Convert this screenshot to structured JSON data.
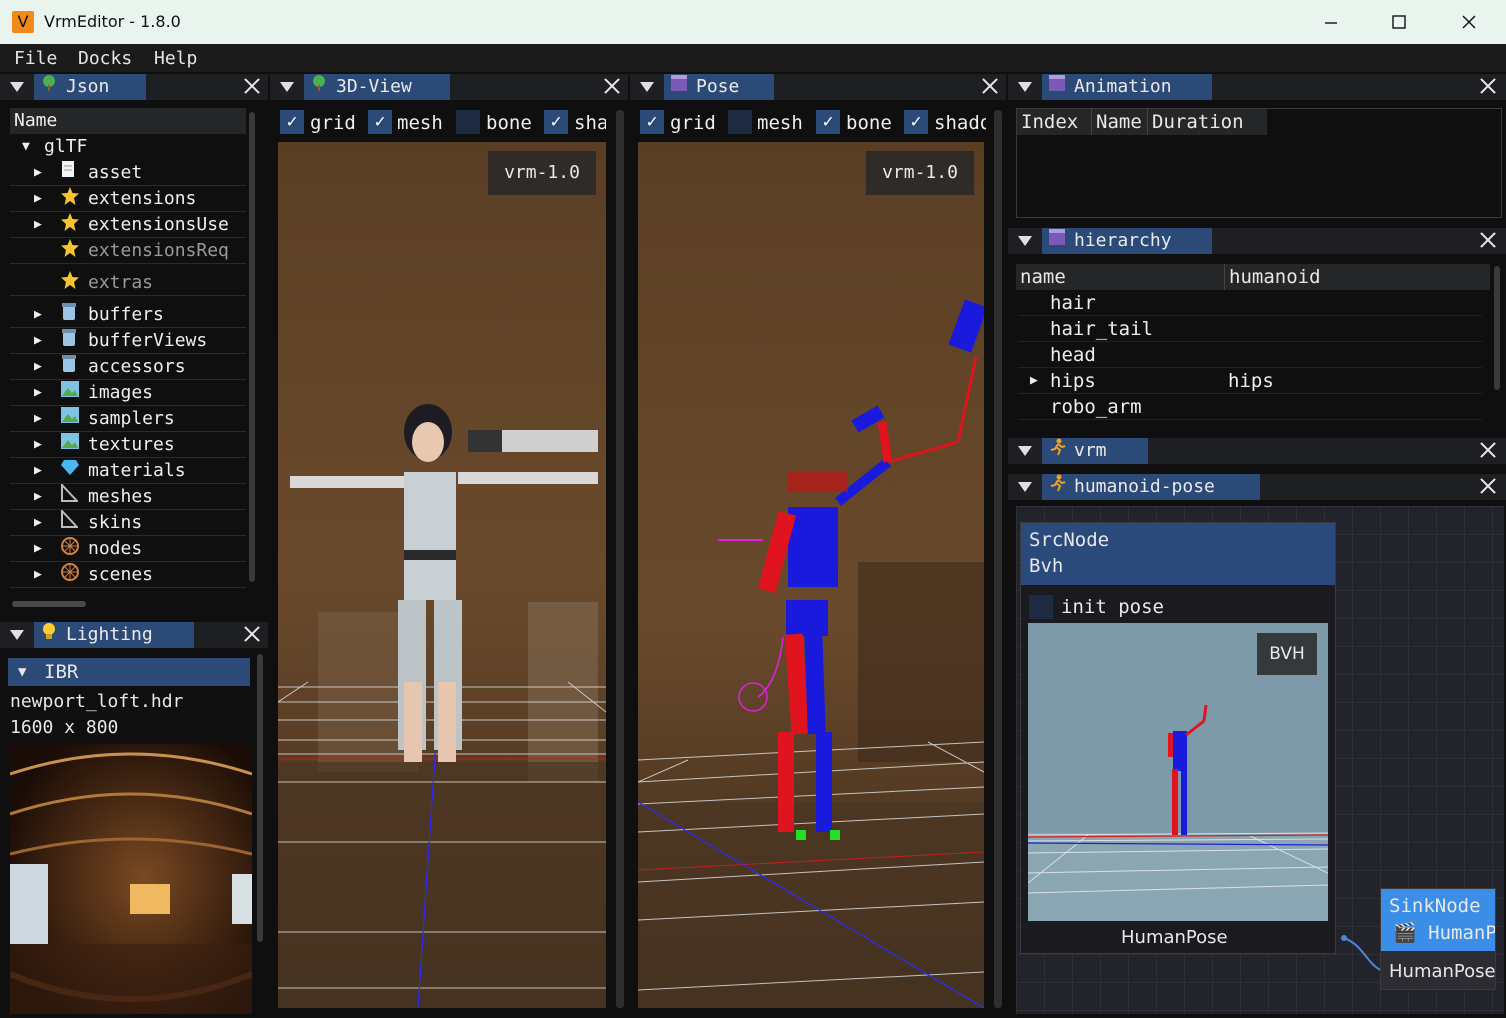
{
  "window": {
    "app_icon_letter": "V",
    "title": "VrmEditor - 1.8.0"
  },
  "menu": [
    "File",
    "Docks",
    "Help"
  ],
  "json_panel": {
    "tab": "Json",
    "header": "Name",
    "root": "glTF",
    "items": [
      {
        "label": "asset",
        "icon": "doc-icon",
        "expandable": true
      },
      {
        "label": "extensions",
        "icon": "star-icon",
        "expandable": true
      },
      {
        "label": "extensionsUse",
        "icon": "star-icon",
        "expandable": true
      },
      {
        "label": "extensionsReq",
        "icon": "star-icon",
        "expandable": false,
        "dim": true
      },
      {
        "label": "extras",
        "icon": "star-icon",
        "expandable": false,
        "dim": true
      },
      {
        "label": "buffers",
        "icon": "jar-icon",
        "expandable": true
      },
      {
        "label": "bufferViews",
        "icon": "jar-icon",
        "expandable": true
      },
      {
        "label": "accessors",
        "icon": "jar-icon",
        "expandable": true
      },
      {
        "label": "images",
        "icon": "picture-icon",
        "expandable": true
      },
      {
        "label": "samplers",
        "icon": "picture-icon",
        "expandable": true
      },
      {
        "label": "textures",
        "icon": "picture-icon",
        "expandable": true
      },
      {
        "label": "materials",
        "icon": "gem-icon",
        "expandable": true
      },
      {
        "label": "meshes",
        "icon": "triangle-ruler-icon",
        "expandable": true
      },
      {
        "label": "skins",
        "icon": "triangle-ruler-icon",
        "expandable": true
      },
      {
        "label": "nodes",
        "icon": "wheel-icon",
        "expandable": true
      },
      {
        "label": "scenes",
        "icon": "wheel-icon",
        "expandable": true
      }
    ]
  },
  "lighting_panel": {
    "tab": "Lighting",
    "section": "IBR",
    "file": "newport_loft.hdr",
    "size": "1600 x 800"
  },
  "view3d_panel": {
    "tab": "3D-View",
    "toggles": [
      {
        "label": "grid",
        "on": true
      },
      {
        "label": "mesh",
        "on": true
      },
      {
        "label": "bone",
        "on": false
      },
      {
        "label": "sha",
        "on": true
      }
    ],
    "badge": "vrm-1.0"
  },
  "pose_panel": {
    "tab": "Pose",
    "toggles": [
      {
        "label": "grid",
        "on": true
      },
      {
        "label": "mesh",
        "on": false
      },
      {
        "label": "bone",
        "on": true
      },
      {
        "label": "shado",
        "on": true
      }
    ],
    "badge": "vrm-1.0"
  },
  "animation_panel": {
    "tab": "Animation",
    "columns": [
      "Index",
      "Name",
      "Duration"
    ]
  },
  "hierarchy_panel": {
    "tab": "hierarchy",
    "columns": [
      "name",
      "humanoid"
    ],
    "rows": [
      {
        "name": "hair",
        "humanoid": "",
        "expandable": false
      },
      {
        "name": "hair_tail",
        "humanoid": "",
        "expandable": false
      },
      {
        "name": "head",
        "humanoid": "",
        "expandable": false
      },
      {
        "name": "hips",
        "humanoid": "hips",
        "expandable": true
      },
      {
        "name": "robo_arm",
        "humanoid": "",
        "expandable": false
      }
    ]
  },
  "vrm_panel": {
    "tab": "vrm"
  },
  "humanoid_pose_panel": {
    "tab": "humanoid-pose",
    "src_node": {
      "title": "SrcNode",
      "subtitle": "Bvh",
      "checkbox": "init pose",
      "badge": "BVH",
      "output": "HumanPose"
    },
    "sink_node": {
      "title": "SinkNode",
      "subtitle": "HumanP",
      "input": "HumanPose"
    }
  },
  "colors": {
    "accent": "#2b4a77",
    "node_header": "#2a4a7c",
    "bone_red": "#e0141e",
    "bone_blue": "#1a1adc"
  }
}
